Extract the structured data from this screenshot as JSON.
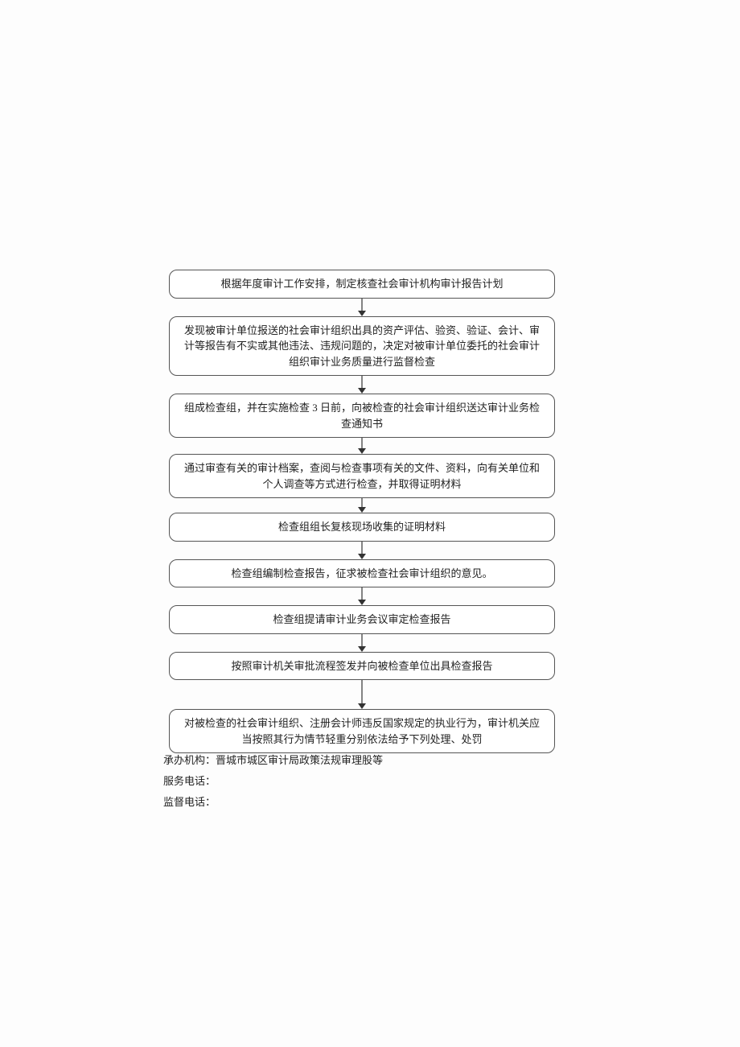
{
  "flow": {
    "steps": [
      "根据年度审计工作安排，制定核查社会审计机构审计报告计划",
      "发现被审计单位报送的社会审计组织出具的资产评估、验资、验证、会计、审计等报告有不实或其他违法、违规问题的，决定对被审计单位委托的社会审计组织审计业务质量进行监督检查",
      "组成检查组，并在实施检查 3 日前，向被检查的社会审计组织送达审计业务检查通知书",
      "通过审查有关的审计档案，查阅与检查事项有关的文件、资料，向有关单位和个人调查等方式进行检查，并取得证明材料",
      "检查组组长复核现场收集的证明材料",
      "检查组编制检查报告，征求被检查社会审计组织的意见。",
      "检查组提请审计业务会议审定检查报告",
      "按照审计机关审批流程签发并向被检查单位出具检查报告",
      "对被检查的社会审计组织、注册会计师违反国家规定的执业行为，审计机关应当按照其行为情节轻重分别依法给予下列处理、处罚"
    ]
  },
  "footer": {
    "org_label": "承办机构：",
    "org_value": "晋城市城区审计局政策法规审理股等",
    "service_label": "服务电话：",
    "service_value": "",
    "supervise_label": "监督电话：",
    "supervise_value": ""
  },
  "arrow_heights": [
    22,
    22,
    20,
    18,
    22,
    22,
    22,
    36
  ]
}
